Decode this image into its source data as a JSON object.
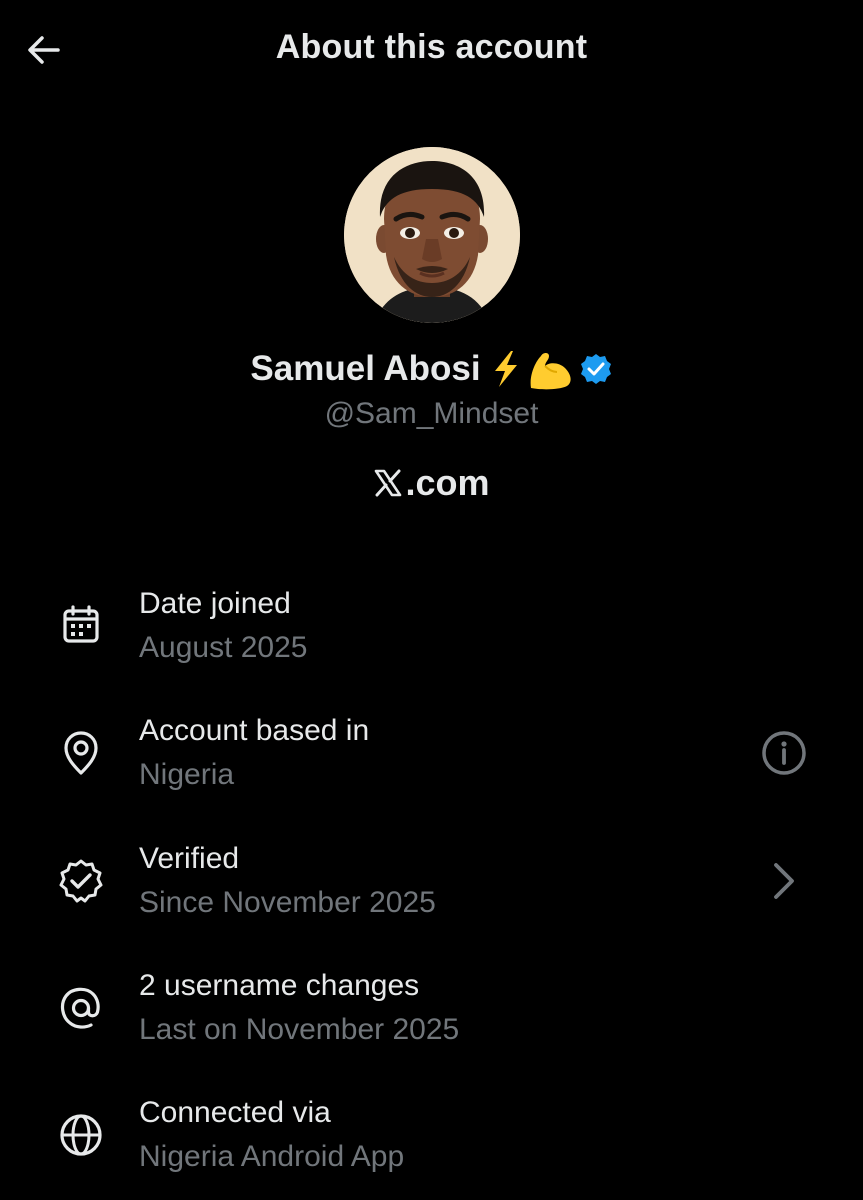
{
  "header": {
    "title": "About this account",
    "back_icon": "arrow-left-icon"
  },
  "profile": {
    "display_name": "Samuel Abosi",
    "emojis": [
      "lightning-emoji",
      "flexed-biceps-emoji"
    ],
    "verified_badge": "blue-checkmark-icon",
    "handle": "@Sam_Mindset",
    "site_suffix": ".com",
    "site_logo": "x-logo-icon"
  },
  "details": [
    {
      "icon": "calendar-icon",
      "title": "Date joined",
      "subtitle": "August 2025"
    },
    {
      "icon": "location-pin-icon",
      "title": "Account based in",
      "subtitle": "Nigeria",
      "action_icon": "info-icon"
    },
    {
      "icon": "verified-badge-icon",
      "title": "Verified",
      "subtitle": "Since November 2025",
      "action_icon": "chevron-right-icon"
    },
    {
      "icon": "at-sign-icon",
      "title": "2 username changes",
      "subtitle": "Last on November 2025"
    },
    {
      "icon": "globe-icon",
      "title": "Connected via",
      "subtitle": "Nigeria Android App"
    }
  ],
  "colors": {
    "background": "#000000",
    "primary_text": "#e7e9ea",
    "secondary_text": "#71767b",
    "verified_blue": "#1d9bf0",
    "emoji_yellow": "#ffcc2f"
  }
}
